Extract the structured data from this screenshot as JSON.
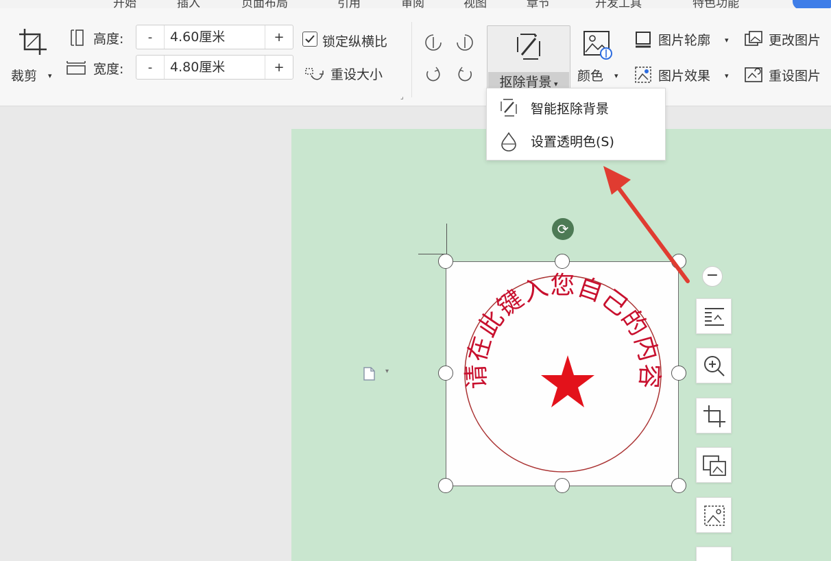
{
  "tabs": [
    "开始",
    "插入",
    "页面布局",
    "引用",
    "审阅",
    "视图",
    "章节",
    "开发工具",
    "特色功能"
  ],
  "ribbon": {
    "crop_label": "裁剪",
    "height_label": "高度:",
    "height_value": "4.60厘米",
    "width_label": "宽度:",
    "width_value": "4.80厘米",
    "spin_minus": "-",
    "spin_plus": "+",
    "lock_ratio_label": "锁定纵横比",
    "lock_ratio_checked": true,
    "reset_size_label": "重设大小",
    "remove_bg_label": "抠除背景",
    "color_label": "颜色",
    "outline_label": "图片轮廓",
    "effects_label": "图片效果",
    "change_pic_label": "更改图片",
    "reset_pic_label": "重设图片"
  },
  "dropdown": {
    "items": [
      {
        "label": "智能抠除背景",
        "icon": "magic-wand-icon"
      },
      {
        "label": "设置透明色(S)",
        "icon": "water-drop-icon"
      }
    ]
  },
  "seal": {
    "text": "请在此键入您自己的内容",
    "color": "#c8102e",
    "star_color": "#e3121b"
  },
  "colors": {
    "page_bg": "#c9e6cf",
    "arrow": "#e03c31",
    "accent_tab": "#3f7ee8"
  },
  "side_tools": [
    "text-wrap-icon",
    "zoom-icon",
    "crop-icon",
    "replace-image-icon",
    "image-edit-icon"
  ]
}
